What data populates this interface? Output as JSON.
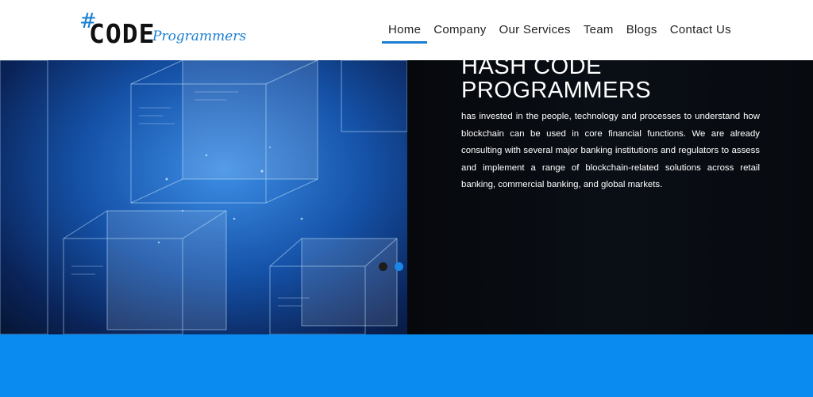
{
  "logo": {
    "hash": "#",
    "code": "CODE",
    "programmers": "Programmers"
  },
  "nav": {
    "items": [
      {
        "label": "Home",
        "active": true
      },
      {
        "label": "Company"
      },
      {
        "label": "Our Services"
      },
      {
        "label": "Team"
      },
      {
        "label": "Blogs"
      },
      {
        "label": "Contact Us"
      }
    ]
  },
  "hero": {
    "title_line1": "HASH CODE",
    "title_line2": "PROGRAMMERS",
    "body": "has invested in the people, technology and processes to understand how blockchain can be used in core financial functions. We are already consulting with several major banking institutions and regulators to assess and implement a range of blockchain-related solutions across retail banking, commercial banking, and global markets."
  },
  "slider": {
    "slide_count": 2,
    "active_slide": 2
  },
  "colors": {
    "accent": "#1a7fd0",
    "band": "#0a8bef",
    "hero_dark": "#05080d"
  }
}
